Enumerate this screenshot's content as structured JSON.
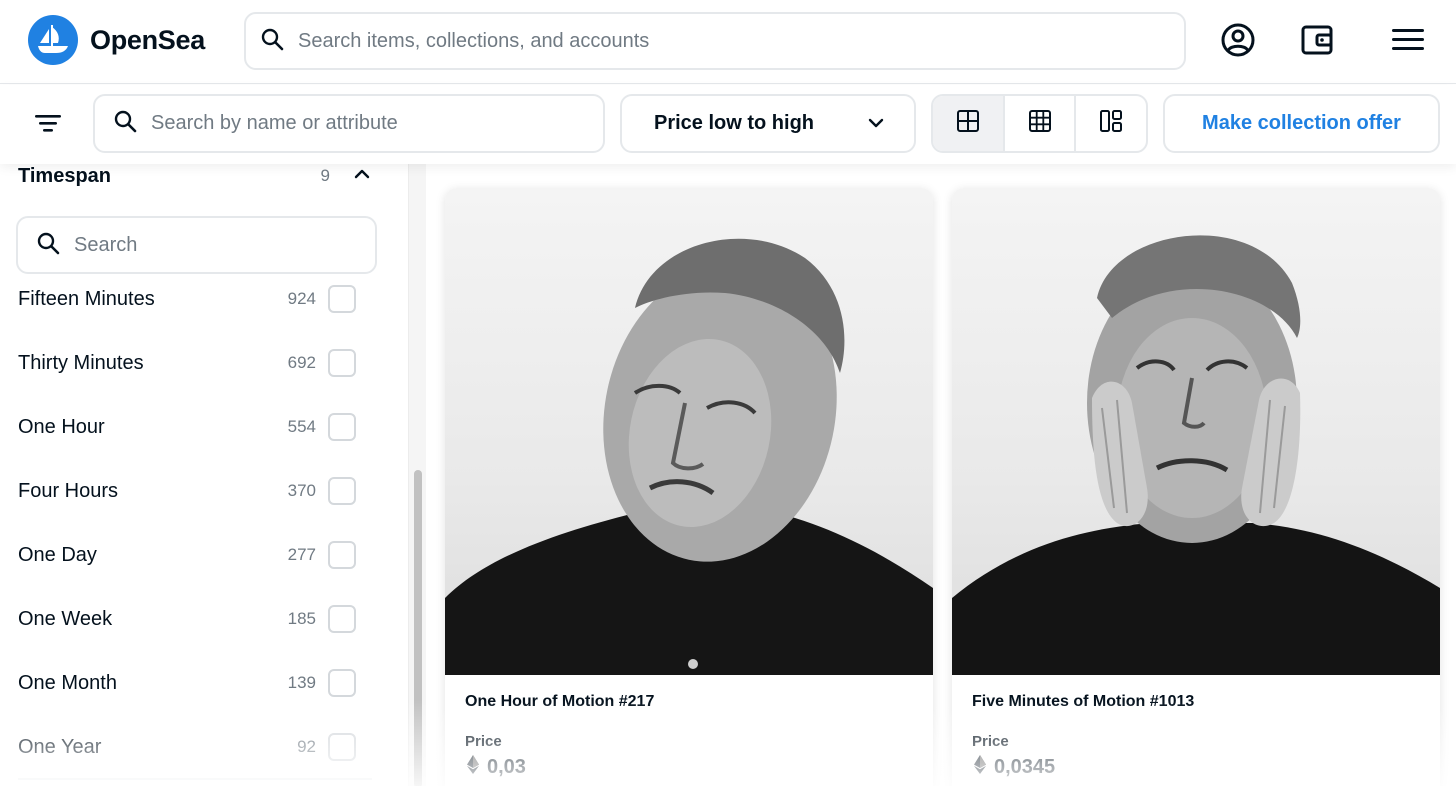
{
  "app": {
    "name": "OpenSea"
  },
  "colors": {
    "brand": "#2081e2",
    "text": "#04111d",
    "muted": "#707a83",
    "border": "#e5e8eb"
  },
  "header": {
    "search_placeholder": "Search items, collections, and accounts",
    "icons": [
      "profile-icon",
      "wallet-icon",
      "menu-icon"
    ]
  },
  "toolbar": {
    "attribute_search_placeholder": "Search by name or attribute",
    "sort_selected": "Price low to high",
    "view_modes": [
      "grid-large-icon",
      "grid-small-icon",
      "mosaic-icon"
    ],
    "active_view": "grid-large-icon",
    "offer_button": "Make collection offer"
  },
  "sidebar": {
    "section_title": "Timespan",
    "section_count": "9",
    "search_placeholder": "Search",
    "items": [
      {
        "label": "Fifteen Minutes",
        "count": "924",
        "checked": false
      },
      {
        "label": "Thirty Minutes",
        "count": "692",
        "checked": false
      },
      {
        "label": "One Hour",
        "count": "554",
        "checked": false
      },
      {
        "label": "Four Hours",
        "count": "370",
        "checked": false
      },
      {
        "label": "One Day",
        "count": "277",
        "checked": false
      },
      {
        "label": "One Week",
        "count": "185",
        "checked": false
      },
      {
        "label": "One Month",
        "count": "139",
        "checked": false
      },
      {
        "label": "One Year",
        "count": "92",
        "checked": false
      }
    ]
  },
  "cards": [
    {
      "name": "One Hour of Motion #217",
      "price_label": "Price",
      "price": "0,03",
      "currency_icon": "ethereum-icon"
    },
    {
      "name": "Five Minutes of Motion #1013",
      "price_label": "Price",
      "price": "0,0345",
      "currency_icon": "ethereum-icon"
    }
  ]
}
